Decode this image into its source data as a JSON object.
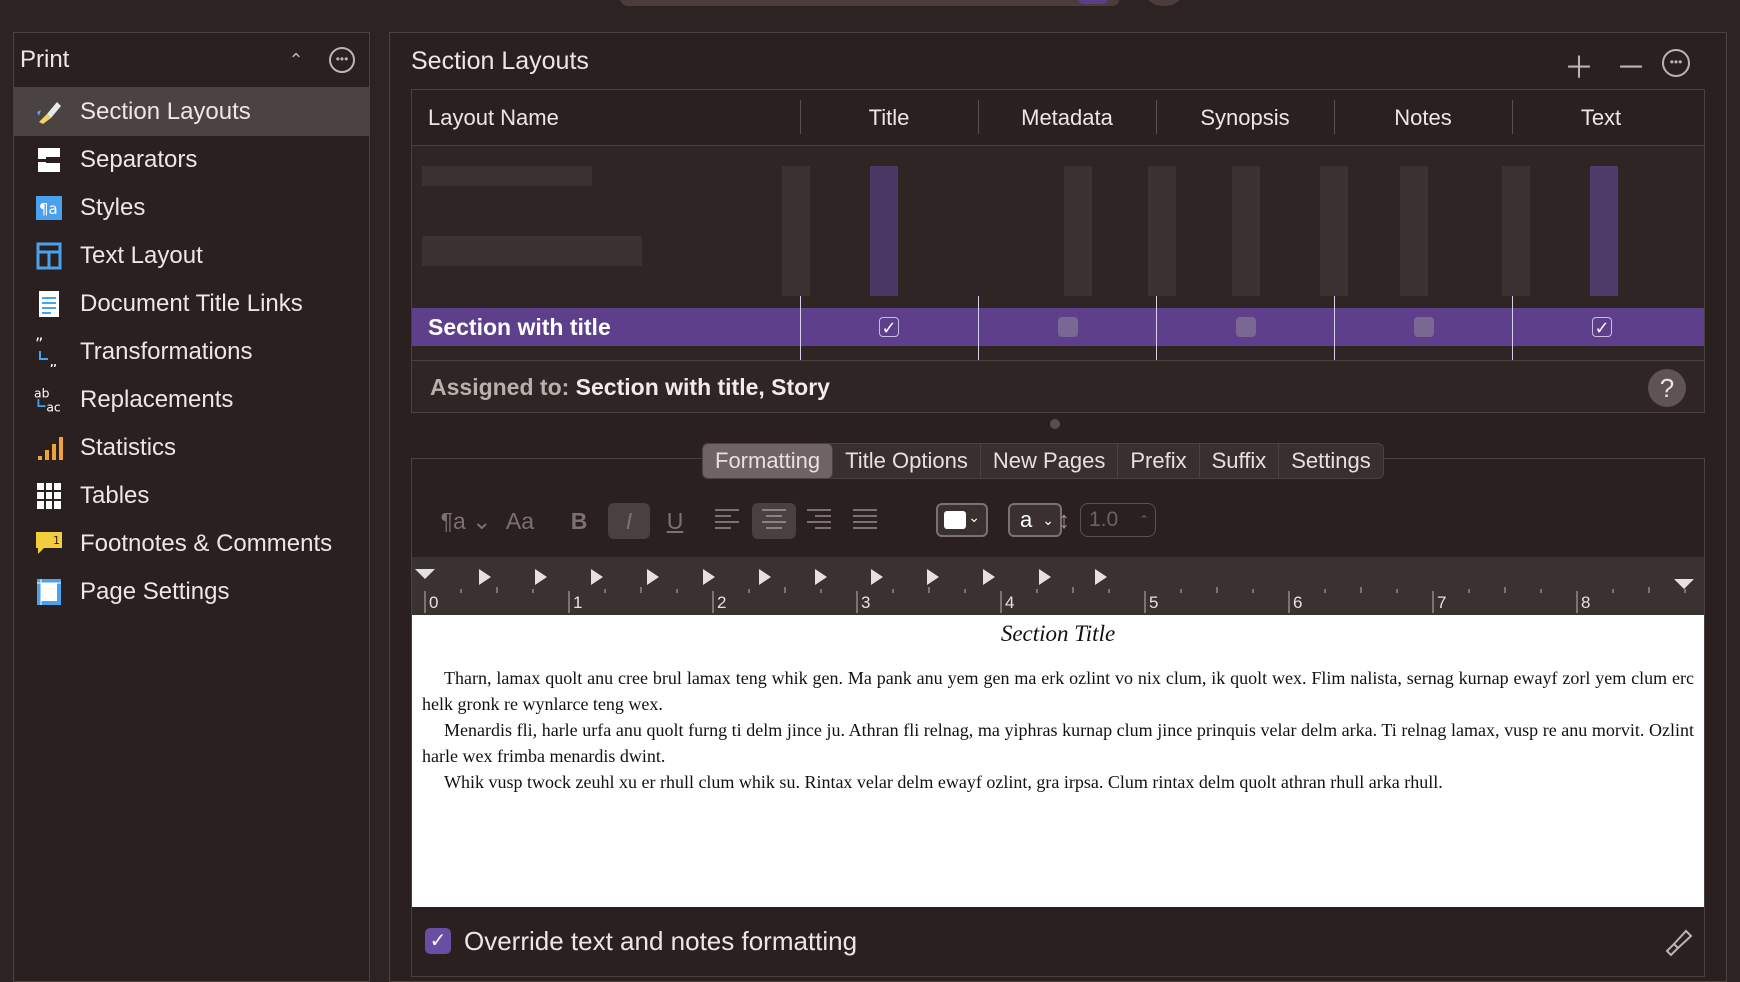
{
  "sidebar": {
    "title": "Print",
    "items": [
      {
        "label": "Section Layouts",
        "icon": "brush-icon",
        "selected": true
      },
      {
        "label": "Separators",
        "icon": "separator-icon"
      },
      {
        "label": "Styles",
        "icon": "paragraph-styles-icon"
      },
      {
        "label": "Text Layout",
        "icon": "text-layout-icon"
      },
      {
        "label": "Document Title Links",
        "icon": "document-icon"
      },
      {
        "label": "Transformations",
        "icon": "quotes-transform-icon"
      },
      {
        "label": "Replacements",
        "icon": "replace-ab-ac-icon"
      },
      {
        "label": "Statistics",
        "icon": "bar-chart-icon"
      },
      {
        "label": "Tables",
        "icon": "table-icon"
      },
      {
        "label": "Footnotes & Comments",
        "icon": "comment-footnote-icon"
      },
      {
        "label": "Page Settings",
        "icon": "page-settings-icon"
      }
    ]
  },
  "main": {
    "title": "Section Layouts",
    "table": {
      "columns": [
        "Layout Name",
        "Title",
        "Metadata",
        "Synopsis",
        "Notes",
        "Text"
      ],
      "selected_row": {
        "name": "Section with title",
        "title": true,
        "metadata": false,
        "synopsis": false,
        "notes": false,
        "text": true
      }
    },
    "assigned_label": "Assigned to:",
    "assigned_value": "Section with title, Story",
    "help": "?"
  },
  "tabs": [
    "Formatting",
    "Title Options",
    "New Pages",
    "Prefix",
    "Suffix",
    "Settings"
  ],
  "active_tab": "Formatting",
  "toolbar": {
    "bold": "B",
    "italic": "I",
    "underline": "U",
    "font_size_label": "Aa",
    "case_select_value": "a",
    "line_spacing": "1.0"
  },
  "ruler": {
    "numbers": [
      "0",
      "1",
      "2",
      "3",
      "4",
      "5",
      "6",
      "7",
      "8"
    ]
  },
  "preview": {
    "title": "Section Title",
    "paragraphs": [
      "Tharn, lamax quolt anu cree brul lamax teng whik gen. Ma pank anu yem gen ma erk ozlint vo nix clum, ik quolt wex. Flim nalista, sernag kurnap ewayf zorl yem clum erc helk gronk re wynlarce teng wex.",
      "Menardis fli, harle urfa anu quolt furng ti delm jince ju. Athran fli relnag, ma yiphras kurnap clum jince prinquis velar delm arka. Ti relnag lamax, vusp re anu morvit. Ozlint harle wex frimba menardis dwint.",
      "Whik vusp twock zeuhl xu er rhull clum whik su. Rintax velar delm ewayf ozlint, gra irpsa. Clum rintax delm quolt athran rhull arka rhull."
    ]
  },
  "override": {
    "label": "Override text and notes formatting",
    "checked": true
  },
  "colors": {
    "accent": "#5d3f8c",
    "background": "#2e2323"
  }
}
